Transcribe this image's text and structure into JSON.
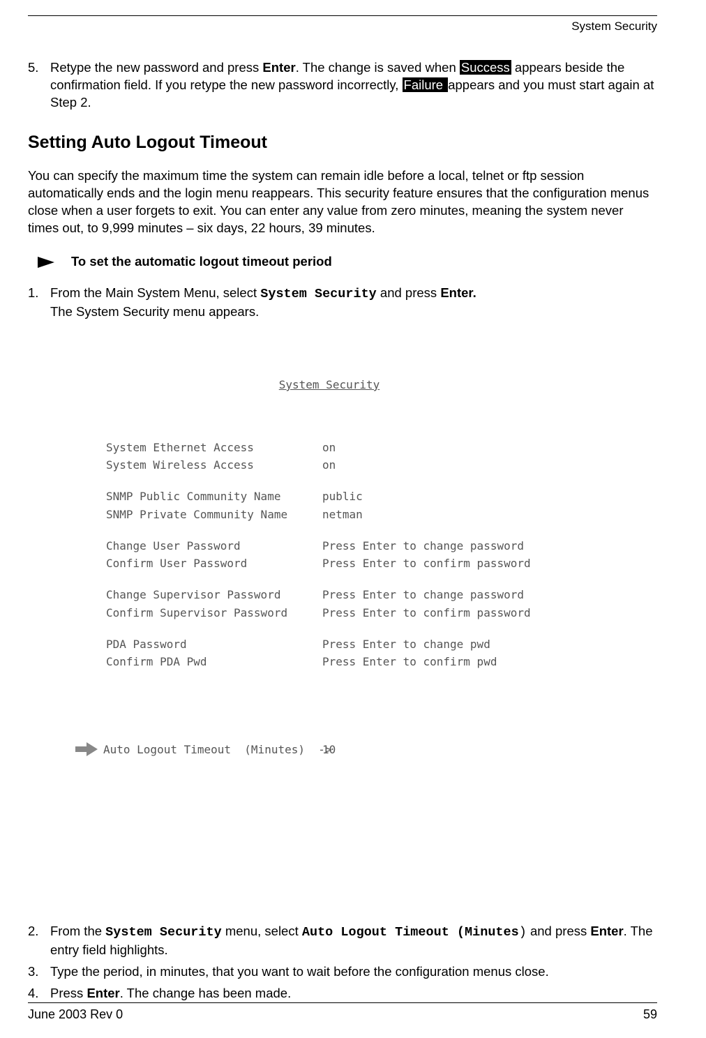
{
  "header": {
    "title": "System Security"
  },
  "step5": {
    "num": "5.",
    "text_a": "Retype the new password and press ",
    "enter": "Enter",
    "text_b": ". The change is saved when ",
    "success": "Success",
    "text_c": " appears beside the confirmation field. If you retype the new password incorrectly, ",
    "failure": "Failure ",
    "text_d": " appears and you must start again at Step 2."
  },
  "heading": "Setting Auto Logout Timeout",
  "intro": "You can specify the maximum time the system can remain idle before a local, telnet or ftp session automatically ends and the login menu reappears. This security feature ensures that the configuration menus close when a user forgets to exit. You can enter any value from zero minutes, meaning the system never times out, to 9,999 minutes – six days, 22 hours, 39 minutes.",
  "procedure_title": "To set the automatic logout timeout period",
  "steps": [
    {
      "num": "1.",
      "text_a": "From the Main System Menu, select ",
      "code1": "System Security",
      "text_b": " and press ",
      "enter": "Enter.",
      "text_c": "The System Security menu appears."
    },
    {
      "num": "2.",
      "text_a": "From the ",
      "code1": "System Security",
      "text_b": " menu, select ",
      "code2": "Auto Logout Timeout (Minutes",
      "paren": ")",
      "text_c": " and press ",
      "enter": "Enter",
      "text_d": ". The entry field highlights."
    },
    {
      "num": "3.",
      "text": "Type the period, in minutes, that you want to wait before the configuration menus close."
    },
    {
      "num": "4.",
      "text_a": "Press ",
      "enter": "Enter",
      "text_b": ". The change has been made."
    }
  ],
  "screen": {
    "title": "System Security",
    "rows": [
      {
        "label": "System Ethernet Access",
        "val": "on"
      },
      {
        "label": "System Wireless Access",
        "val": "on"
      },
      {
        "gap": true
      },
      {
        "label": "SNMP Public Community Name",
        "val": "public"
      },
      {
        "label": "SNMP Private Community Name",
        "val": "netman"
      },
      {
        "gap": true
      },
      {
        "label": "Change User Password",
        "val": "Press Enter to change password"
      },
      {
        "label": "Confirm User Password",
        "val": "Press Enter to confirm password"
      },
      {
        "gap": true
      },
      {
        "label": "Change Supervisor Password",
        "val": "Press Enter to change password"
      },
      {
        "label": "Confirm Supervisor Password",
        "val": "Press Enter to confirm password"
      },
      {
        "gap": true
      },
      {
        "label": "PDA Password",
        "val": "Press Enter to change pwd"
      },
      {
        "label": "Confirm PDA Pwd",
        "val": "Press Enter to confirm pwd"
      }
    ],
    "auto_row": {
      "label": "Auto Logout Timeout  (Minutes)  ->",
      "val": "10"
    }
  },
  "footer": {
    "left": "June 2003 Rev 0",
    "right": "59"
  }
}
